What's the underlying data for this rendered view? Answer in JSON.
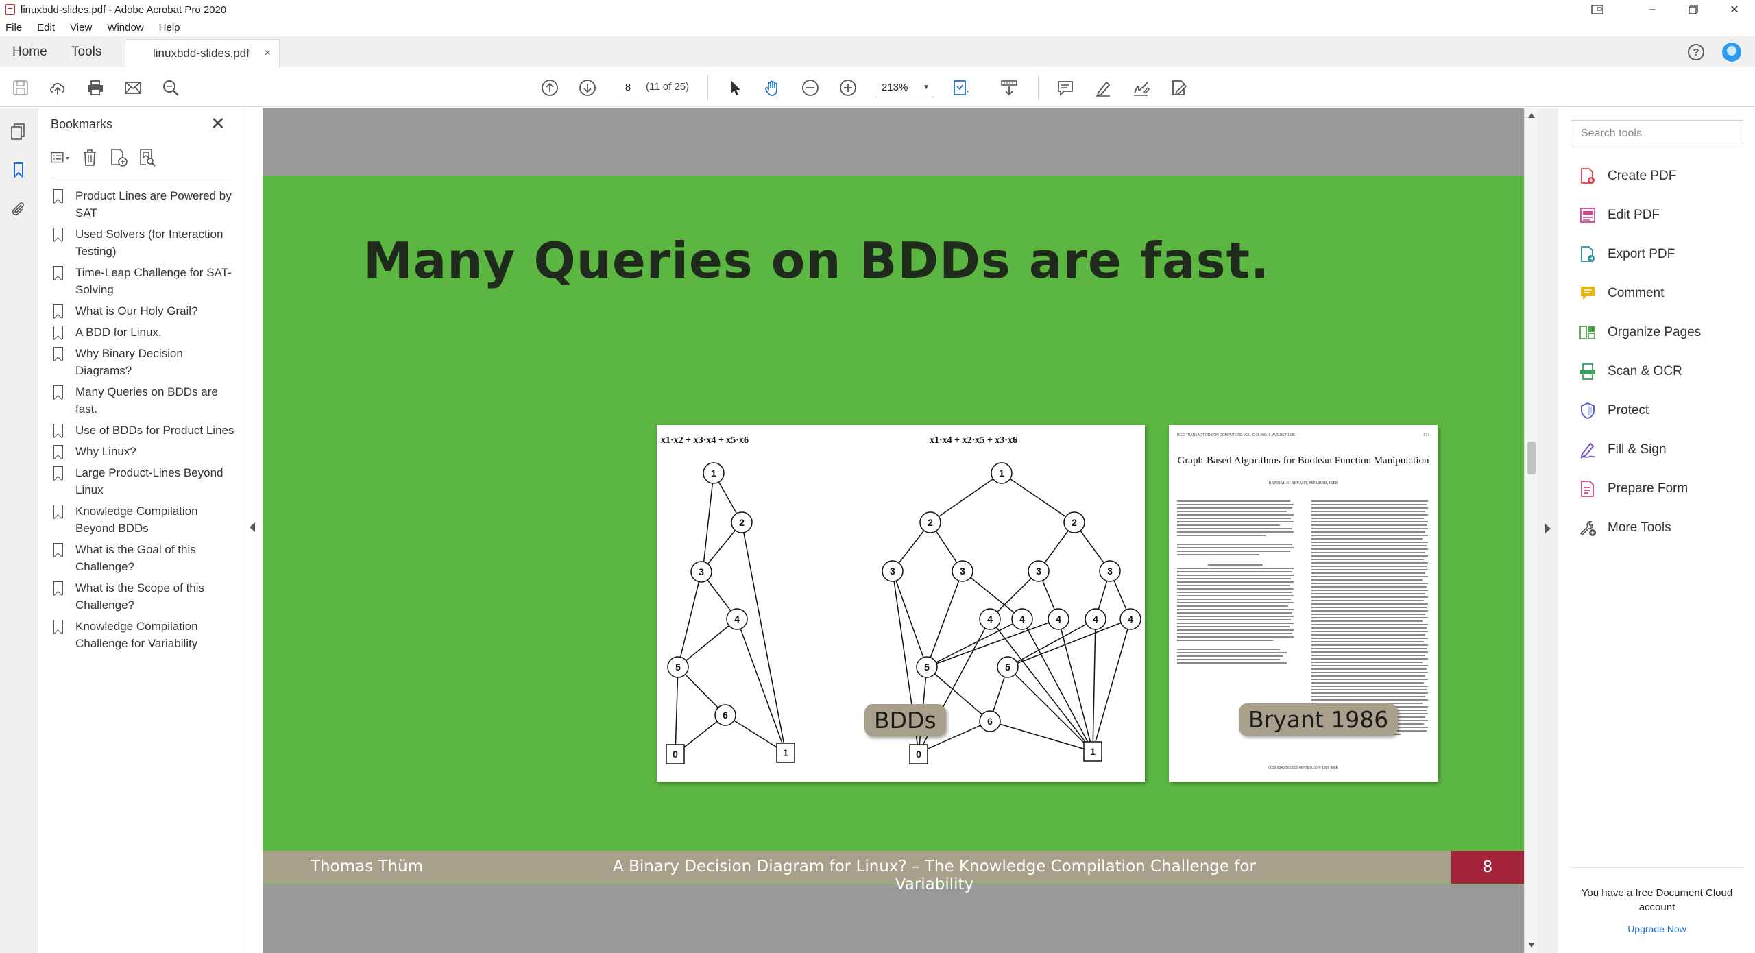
{
  "window": {
    "title": "linuxbdd-slides.pdf - Adobe Acrobat Pro 2020"
  },
  "menu": [
    "File",
    "Edit",
    "View",
    "Window",
    "Help"
  ],
  "tabs": {
    "home": "Home",
    "tools": "Tools",
    "document": "linuxbdd-slides.pdf",
    "close": "×"
  },
  "toolbar": {
    "page_number": "8",
    "page_count": "(11 of 25)",
    "zoom": "213%"
  },
  "bookmarks": {
    "header": "Bookmarks",
    "close": "✕",
    "items": [
      "Product Lines are Powered by SAT",
      "Used Solvers (for Interaction Testing)",
      "Time-Leap Challenge for SAT-Solving",
      "What is Our Holy Grail?",
      "A BDD for Linux.",
      "Why Binary Decision Diagrams?",
      "Many Queries on BDDs are fast.",
      "Use of BDDs for Product Lines",
      "Why Linux?",
      "Large Product-Lines Beyond Linux",
      "Knowledge Compilation Beyond BDDs",
      "What is the Goal of this Challenge?",
      "What is the Scope of this Challenge?",
      "Knowledge Compilation Challenge for Variability"
    ]
  },
  "slide": {
    "title": "Many Queries on BDDs are fast.",
    "label_bdds": "BDDs",
    "label_bryant": "Bryant 1986",
    "footer_author": "Thomas Thüm",
    "footer_title": "A Binary Decision Diagram for Linux? – The Knowledge Compilation Challenge for Variability",
    "footer_page": "8",
    "bdd_left_formula": "x1·x2 + x3·x4 + x5·x6",
    "bdd_right_formula": "x1·x4 + x2·x5 + x3·x6",
    "paper_title": "Graph-Based Algorithms for Boolean Function Manipulation",
    "paper_author": "RANDAL E. BRYANT, MEMBER, IEEE",
    "paper_journal": "IEEE TRANSACTIONS ON COMPUTERS, VOL. C-35, NO. 8, AUGUST 1986",
    "paper_page": "677",
    "paper_footer": "0018-9340/86/0800-0677$01.00 © 1986 IEEE"
  },
  "tools": {
    "search_placeholder": "Search tools",
    "items": [
      {
        "label": "Create PDF",
        "color": "#e0454b"
      },
      {
        "label": "Edit PDF",
        "color": "#d9418a"
      },
      {
        "label": "Export PDF",
        "color": "#2f8c9e"
      },
      {
        "label": "Comment",
        "color": "#e8b20f"
      },
      {
        "label": "Organize Pages",
        "color": "#4fa24d"
      },
      {
        "label": "Scan & OCR",
        "color": "#3aa25c"
      },
      {
        "label": "Protect",
        "color": "#5a5fd6"
      },
      {
        "label": "Fill & Sign",
        "color": "#7d4fd0"
      },
      {
        "label": "Prepare Form",
        "color": "#d9418a"
      },
      {
        "label": "More Tools",
        "color": "#555555"
      }
    ],
    "cloud_message": "You have a free Document Cloud account",
    "upgrade": "Upgrade Now"
  },
  "colors": {
    "slide_green": "#5cb742",
    "footer_tan": "#a9a08c",
    "footer_red": "#a3243a"
  }
}
